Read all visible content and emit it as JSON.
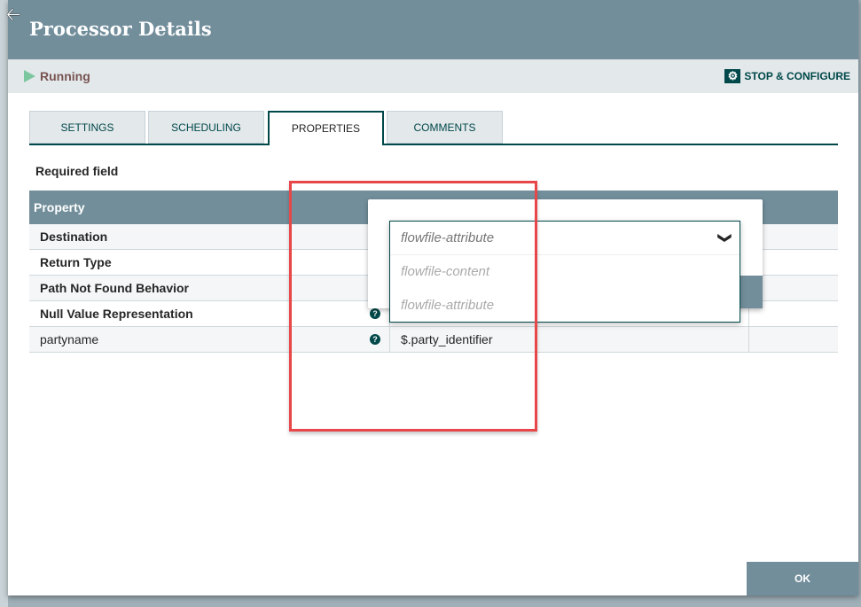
{
  "dialog": {
    "title": "Processor Details",
    "status": "Running",
    "stop_configure": "STOP & CONFIGURE",
    "ok": "OK"
  },
  "tabs": [
    {
      "label": "SETTINGS"
    },
    {
      "label": "SCHEDULING"
    },
    {
      "label": "PROPERTIES",
      "active": true
    },
    {
      "label": "COMMENTS"
    }
  ],
  "required_field": "Required field",
  "table": {
    "header": "Property",
    "rows": [
      {
        "name": "Destination",
        "value": ""
      },
      {
        "name": "Return Type",
        "value": ""
      },
      {
        "name": "Path Not Found Behavior",
        "value": ""
      },
      {
        "name": "Null Value Representation",
        "value": ""
      },
      {
        "name": "partyname",
        "value": "$.party_identifier"
      }
    ]
  },
  "combo": {
    "selected": "flowfile-attribute",
    "options": [
      "flowfile-content",
      "flowfile-attribute"
    ]
  },
  "icons": {
    "help": "?",
    "chevron": "❯",
    "gear": "⚙"
  }
}
